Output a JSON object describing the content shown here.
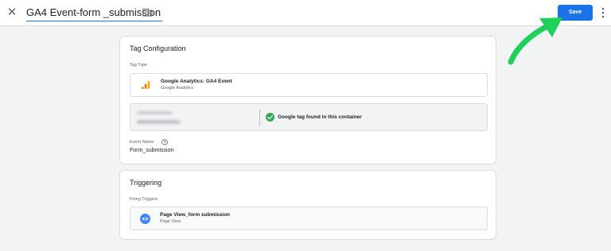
{
  "header": {
    "title": "GA4 Event-form _submission",
    "save_label": "Save"
  },
  "tag_configuration": {
    "card_title": "Tag Configuration",
    "tag_type_label": "Tag Type",
    "tag_type": {
      "name": "Google Analytics: GA4 Event",
      "provider": "Google Analytics",
      "icon": "google-analytics-icon"
    },
    "google_tag_status": "Google tag found in this container",
    "event_name_label": "Event Name",
    "event_name_value": "Form_submission"
  },
  "triggering": {
    "card_title": "Triggering",
    "firing_triggers_label": "Firing Triggers",
    "trigger": {
      "name": "Page View_form submission",
      "type": "Page View",
      "icon": "eye-icon"
    }
  },
  "colors": {
    "accent": "#1a73e8",
    "arrow": "#1fd15b",
    "success": "#34a853"
  }
}
